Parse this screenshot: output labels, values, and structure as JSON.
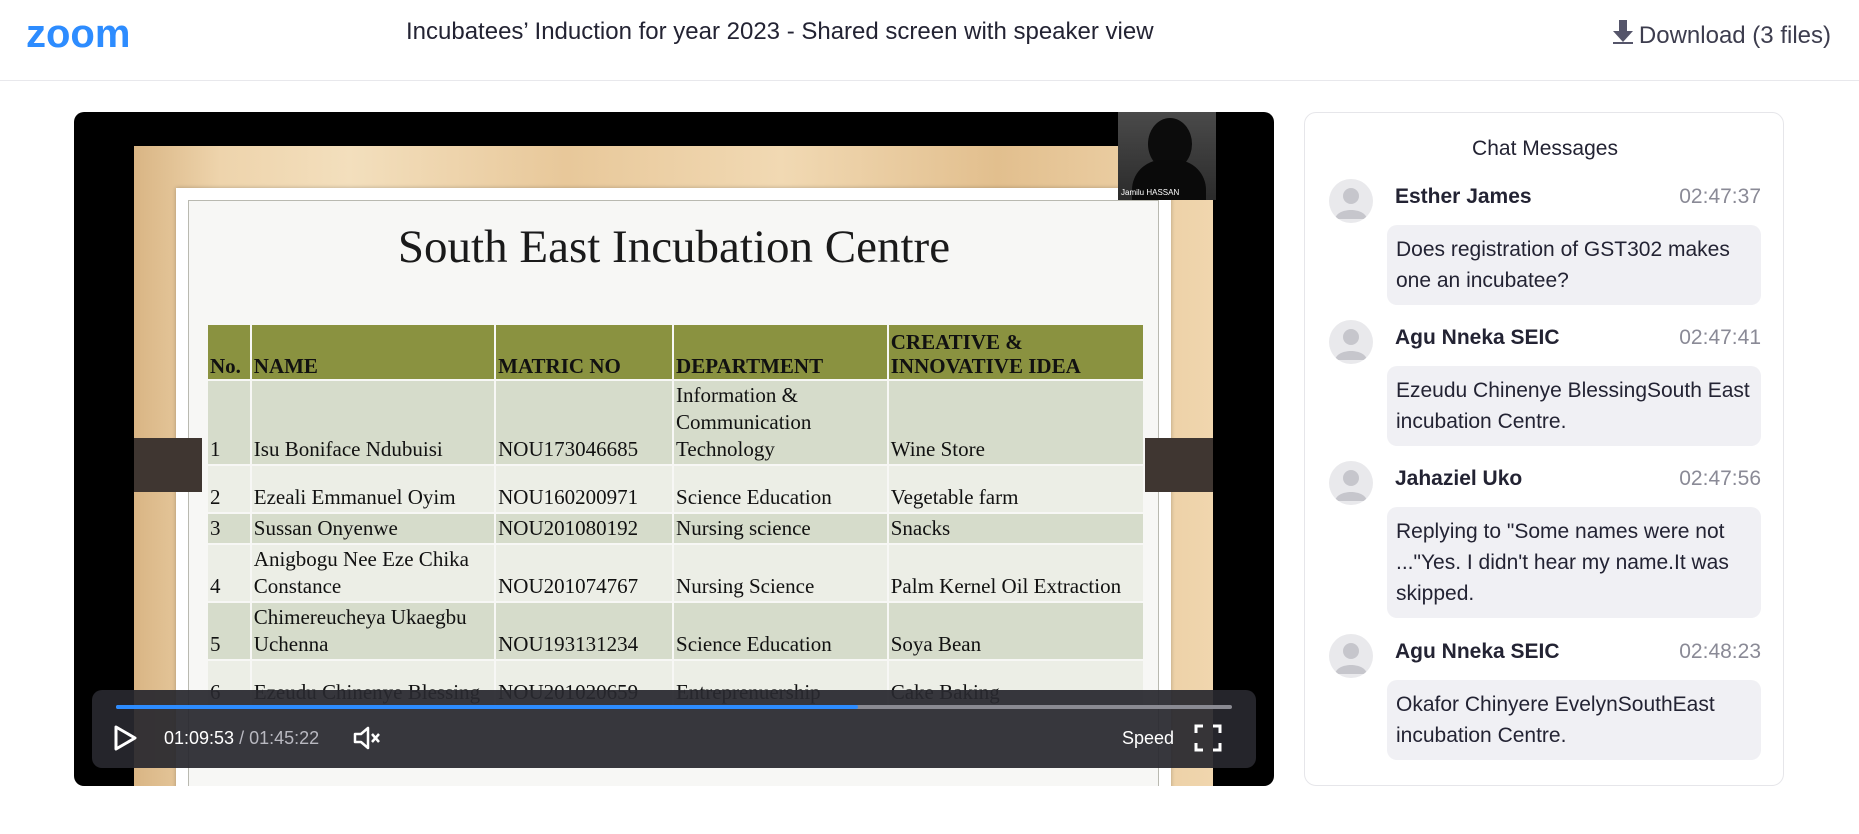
{
  "header": {
    "logo_text": "zoom",
    "title": "Incubatees’ Induction for year 2023 - Shared screen with speaker view",
    "download_label": "Download (3 files)"
  },
  "player": {
    "slide": {
      "title": "South East Incubation Centre",
      "columns": [
        "No.",
        "NAME",
        "MATRIC NO",
        "DEPARTMENT",
        "CREATIVE & INNOVATIVE IDEA"
      ],
      "rows": [
        [
          "1",
          "Isu Boniface Ndubuisi",
          "NOU173046685",
          "Information & Communication Technology",
          "Wine Store"
        ],
        [
          "2",
          "Ezeali Emmanuel Oyim",
          "NOU160200971",
          "Science Education",
          "Vegetable farm"
        ],
        [
          "3",
          "Sussan Onyenwe",
          "NOU201080192",
          "Nursing science",
          "Snacks"
        ],
        [
          "4",
          "Anigbogu Nee Eze Chika Constance",
          "NOU201074767",
          "Nursing Science",
          "Palm Kernel Oil Extraction"
        ],
        [
          "5",
          "Chimereucheya Ukaegbu Uchenna",
          "NOU193131234",
          "Science Education",
          "Soya Bean"
        ],
        [
          "6",
          "Ezeudu Chinenye Blessing",
          "NOU201020659",
          "Entreprenuership",
          "Cake Baking"
        ]
      ]
    },
    "speaker_name": "Jamilu HASSAN",
    "current_time": "01:09:53",
    "time_separator": "/",
    "total_time": "01:45:22",
    "progress": 0.665,
    "speed_label": "Speed",
    "accent_color": "#2d8cff"
  },
  "chat": {
    "title": "Chat Messages",
    "messages": [
      {
        "sender": "Esther James",
        "time": "02:47:37",
        "text": "Does registration of GST302 makes one an incubatee?"
      },
      {
        "sender": "Agu Nneka SEIC",
        "time": "02:47:41",
        "text": "Ezeudu Chinenye BlessingSouth East incubation Centre."
      },
      {
        "sender": "Jahaziel Uko",
        "time": "02:47:56",
        "text": "Replying to \"Some names were not ...\"Yes. I didn't hear my name.It was skipped."
      },
      {
        "sender": "Agu Nneka SEIC",
        "time": "02:48:23",
        "text": "Okafor Chinyere EvelynSouthEast incubation Centre."
      }
    ]
  },
  "icons": {
    "download": "download-arrow-icon",
    "play": "play-icon",
    "volume": "volume-mute-icon",
    "fullscreen": "fullscreen-icon",
    "avatar": "user-avatar-icon"
  }
}
